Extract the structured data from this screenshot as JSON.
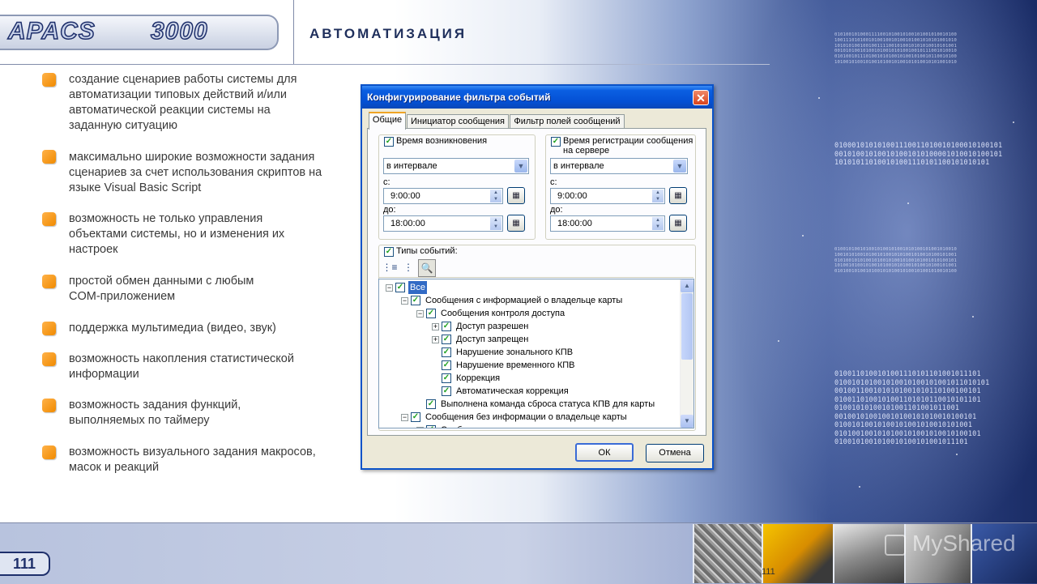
{
  "header": {
    "logo_text": "APACS",
    "logo_number": "3000",
    "title": "АВТОМАТИЗАЦИЯ"
  },
  "bullets": [
    "создание сценариев работы системы для автоматизации типовых действий и/или автоматической реакции системы на заданную ситуацию",
    "максимально широкие возможности задания сценариев за счет использования скриптов на языке Visual Basic Script",
    "возможность не только управления объектами системы, но и изменения их настроек",
    "простой обмен данными с любым COM-приложением",
    "поддержка мультимедиа (видео, звук)",
    "возможность накопления статистической информации",
    "возможность задания функций, выполняемых по таймеру",
    "возможность визуального задания макросов, масок и реакций"
  ],
  "dialog": {
    "title": "Конфигурирование фильтра событий",
    "close_glyph": "✕",
    "tabs": [
      "Общие",
      "Инициатор сообщения",
      "Фильтр полей сообщений"
    ],
    "time_occurred": {
      "label": "Время возникновения",
      "mode": "в интервале",
      "from_label": "с:",
      "from_value": "9:00:00",
      "to_label": "до:",
      "to_value": "18:00:00"
    },
    "time_registered": {
      "label_line1": "Время регистрации сообщения",
      "label_line2": "на сервере",
      "mode": "в интервале",
      "from_label": "с:",
      "from_value": "9:00:00",
      "to_label": "до:",
      "to_value": "18:00:00"
    },
    "event_types_label": "Типы событий:",
    "tree": [
      {
        "label": "Все",
        "level": 0,
        "expander": "−",
        "selected": true
      },
      {
        "label": "Сообщения с информацией о владельце карты",
        "level": 1,
        "expander": "−"
      },
      {
        "label": "Сообщения контроля доступа",
        "level": 2,
        "expander": "−"
      },
      {
        "label": "Доступ разрешен",
        "level": 3,
        "expander": "+"
      },
      {
        "label": "Доступ запрещен",
        "level": 3,
        "expander": "+"
      },
      {
        "label": "Нарушение зонального КПВ",
        "level": 3,
        "expander": ""
      },
      {
        "label": "Нарушение временного КПВ",
        "level": 3,
        "expander": ""
      },
      {
        "label": "Коррекция",
        "level": 3,
        "expander": ""
      },
      {
        "label": "Автоматическая коррекция",
        "level": 3,
        "expander": ""
      },
      {
        "label": "Выполнена команда сброса статуса КПВ для карты",
        "level": 2,
        "expander": ""
      },
      {
        "label": "Сообщения без информации о владельце карты",
        "level": 1,
        "expander": "−"
      },
      {
        "label": "Сообщения контроля доступа",
        "level": 2,
        "expander": "−"
      }
    ],
    "ok_label": "ОК",
    "cancel_label": "Отмена"
  },
  "footer": {
    "page_number": "111",
    "page_number_small": "111",
    "watermark": "MyShared"
  }
}
